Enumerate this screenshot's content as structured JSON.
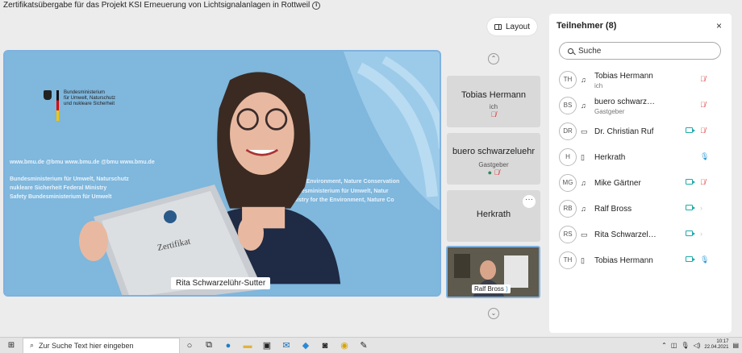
{
  "meeting": {
    "title": "Zertifikatsübergabe für das Projekt KSI Erneuerung von Lichtsignalanlagen in Rottweil",
    "layout_label": "Layout"
  },
  "main_video": {
    "speaker_name": "Rita Schwarzelühr-Sutter",
    "bg_org_lines": [
      "Bundesministerium",
      "für Umwelt, Naturschutz",
      "und nukleare Sicherheit"
    ],
    "bg_urls": "www.bmu.de     @bmu     www.bmu.de     @bmu     www.bmu.de",
    "bg_line1": "Bundesministerium für Umwelt, Naturschutz",
    "bg_line2": "nukleare Sicherheit  Federal Ministry",
    "bg_line3": "Safety  Bundesministerium für Umwelt",
    "bg_line4": "for the Environment, Nature Conservation",
    "bg_line5": "Bundesministerium für Umwelt, Natur",
    "bg_line6": "Ministry for the Environment, Nature Co",
    "cert_text": "Zertifikat"
  },
  "tiles": [
    {
      "name": "Tobias Hermann",
      "role": "ich"
    },
    {
      "name": "buero schwarzeluehr",
      "role": "Gastgeber"
    },
    {
      "name": "Herkrath",
      "more": "···"
    },
    {
      "name": "Ralf Bross"
    }
  ],
  "panel": {
    "title": "Teilnehmer (8)",
    "close": "×",
    "search_placeholder": "Suche",
    "participants": [
      {
        "initials": "TH",
        "name": "Tobias Hermann",
        "role": "ich",
        "device": "headset",
        "camera": false,
        "mic": "off"
      },
      {
        "initials": "BS",
        "name": "buero schwarz…",
        "role": "Gastgeber",
        "device": "headset",
        "camera": false,
        "mic": "off"
      },
      {
        "initials": "DR",
        "name": "Dr. Christian Ruf",
        "device": "desktop",
        "camera": true,
        "mic": "off"
      },
      {
        "initials": "H",
        "name": "Herkrath",
        "device": "phone",
        "camera": false,
        "mic": "on"
      },
      {
        "initials": "MG",
        "name": "Mike Gärtner",
        "device": "headset",
        "camera": true,
        "mic": "off"
      },
      {
        "initials": "RB",
        "name": "Ralf Bross",
        "device": "headset",
        "camera": true,
        "mic": "dim"
      },
      {
        "initials": "RS",
        "name": "Rita Schwarzel…",
        "device": "desktop",
        "camera": true,
        "mic": "dim"
      },
      {
        "initials": "TH",
        "name": "Tobias Hermann",
        "device": "phone",
        "camera": true,
        "mic": "on"
      }
    ]
  },
  "taskbar": {
    "search_text": "Zur Suche Text hier eingeben",
    "time": "10:17",
    "date": "22.04.2021"
  }
}
